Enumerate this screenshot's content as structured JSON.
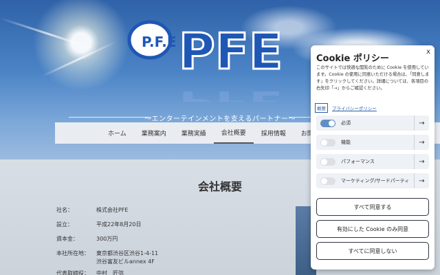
{
  "logo": {
    "text": "PFE",
    "small_text": "P.F.E"
  },
  "tagline": "〜エンターテインメントを支えるパートナー〜",
  "nav": {
    "items": [
      "ホーム",
      "業務案内",
      "業務実績",
      "会社概要",
      "採用情報",
      "お問い"
    ],
    "active_index": 3
  },
  "page_title": "会社概要",
  "company_info": [
    {
      "label": "社名：",
      "value": "株式会社PFE"
    },
    {
      "label": "設立：",
      "value": "平成22年8月20日"
    },
    {
      "label": "資本金：",
      "value": "300万円"
    },
    {
      "label": "本社所在地：",
      "value": "東京都渋谷区渋谷1-4-11",
      "value2": "渋谷富友ビルannex 4F"
    },
    {
      "label": "代表取締役：",
      "value": "中村　匠弥"
    }
  ],
  "cookie": {
    "title": "Cookie ポリシー",
    "close": "x",
    "description": "このサイトでは快適な閲覧のために Cookie を使用しています。Cookie の使用に同意いただける場合は、「同意します」をクリックしてください。詳細については、各項目の右矢印「→」からご確認ください。",
    "summary_link": "概要",
    "privacy_link": "プライバシーポリシー",
    "categories": [
      {
        "label": "必須",
        "on": true
      },
      {
        "label": "機能",
        "on": false
      },
      {
        "label": "パフォーマンス",
        "on": false
      },
      {
        "label": "マーケティング/サードパーティ",
        "on": false
      }
    ],
    "arrow": "→",
    "buttons": {
      "accept_all": "すべて同意する",
      "accept_enabled": "有効にした Cookie のみ同意",
      "decline_all": "すべてに同意しない"
    }
  },
  "colors": {
    "accent": "#5f8fc4",
    "logo_blue": "#1f57b5"
  }
}
